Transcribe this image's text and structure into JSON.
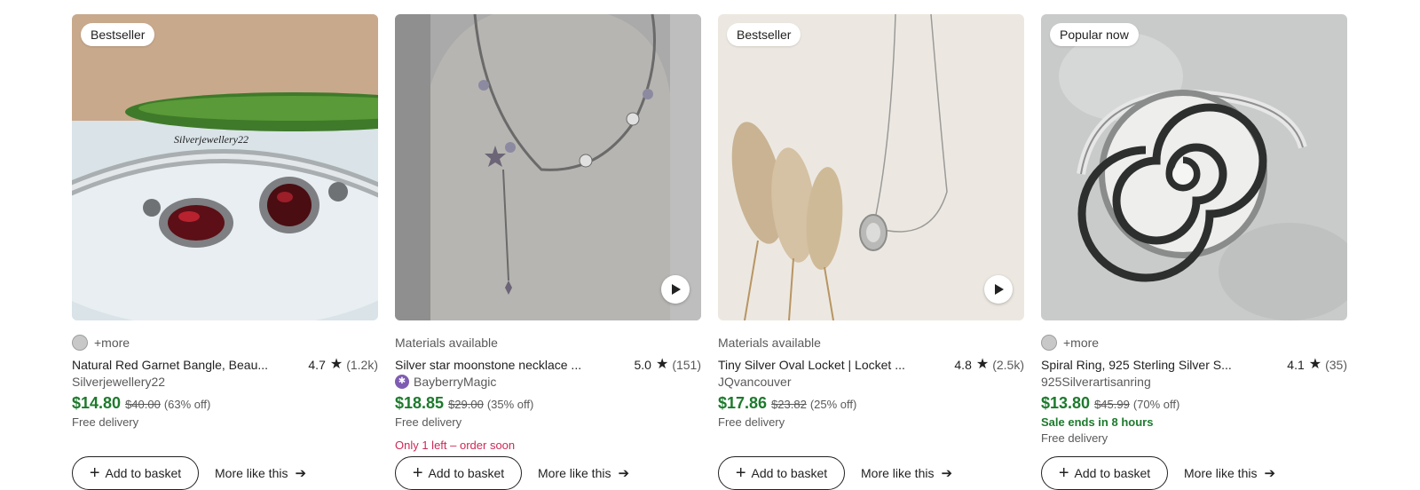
{
  "listings": [
    {
      "badge": "Bestseller",
      "topline": "+more",
      "title": "Natural Red Garnet Bangle, Beau...",
      "rating": "4.7",
      "reviews": "(1.2k)",
      "shop": "Silverjewellery22",
      "price": "$14.80",
      "original_price": "$40.00",
      "discount": "(63% off)",
      "delivery": "Free delivery",
      "watermark": "Silverjewellery22",
      "add_label": "Add to basket",
      "more_label": "More like this"
    },
    {
      "topline": "Materials available",
      "title": "Silver star moonstone necklace ...",
      "rating": "5.0",
      "reviews": "(151)",
      "shop": "BayberryMagic",
      "price": "$18.85",
      "original_price": "$29.00",
      "discount": "(35% off)",
      "delivery": "Free delivery",
      "urgency": "Only 1 left – order soon",
      "add_label": "Add to basket",
      "more_label": "More like this"
    },
    {
      "badge": "Bestseller",
      "topline": "Materials available",
      "title": "Tiny Silver Oval Locket | Locket ...",
      "rating": "4.8",
      "reviews": "(2.5k)",
      "shop": "JQvancouver",
      "price": "$17.86",
      "original_price": "$23.82",
      "discount": "(25% off)",
      "delivery": "Free delivery",
      "add_label": "Add to basket",
      "more_label": "More like this"
    },
    {
      "badge": "Popular now",
      "topline": "+more",
      "title": "Spiral Ring, 925 Sterling Silver S...",
      "rating": "4.1",
      "reviews": "(35)",
      "shop": "925Silverartisanring",
      "price": "$13.80",
      "original_price": "$45.99",
      "discount": "(70% off)",
      "sale_note": "Sale ends in 8 hours",
      "delivery": "Free delivery",
      "add_label": "Add to basket",
      "more_label": "More like this"
    }
  ],
  "colors": {
    "price": "#1d7a2d",
    "urgency": "#cc2a56",
    "star_seller": "#7e5cb3"
  }
}
